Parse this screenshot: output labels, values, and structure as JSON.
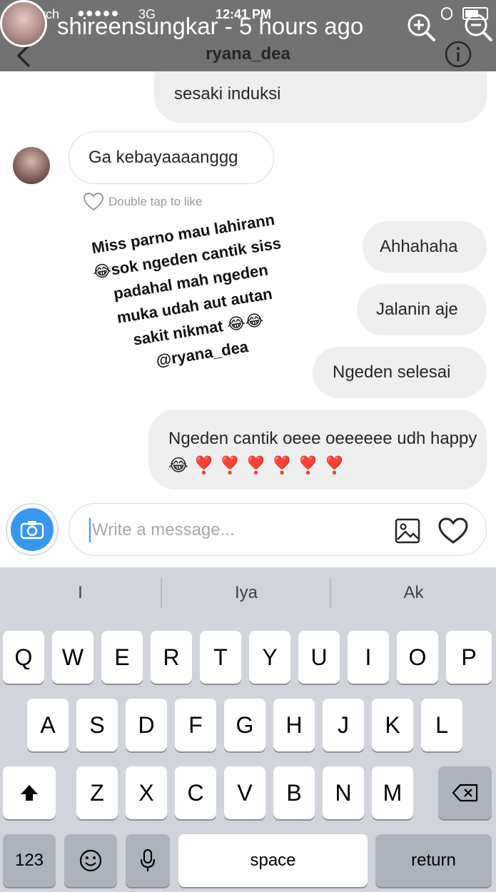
{
  "status_bar": {
    "carrier": "rch",
    "signal": "●●●●●",
    "network": "3G",
    "time": "12:41 PM"
  },
  "story": {
    "username": "shireensungkar",
    "separator": " - ",
    "age": "5 hours ago",
    "caption": "Miss parno mau lahirann\n😂sok ngeden cantik siss\npadahal mah ngeden\nmuka udah aut autan\nsakit nikmat 😂😂\n@ryana_dea"
  },
  "chat": {
    "title": "ryana_dea",
    "messages": [
      {
        "direction": "outgoing",
        "text": "sesaki induksi"
      },
      {
        "direction": "incoming",
        "text": "Ga kebayaaaanggg"
      },
      {
        "direction": "outgoing",
        "text": "Ahhahaha"
      },
      {
        "direction": "outgoing",
        "text": "Jalanin aje"
      },
      {
        "direction": "outgoing",
        "text": "Ngeden selesai"
      },
      {
        "direction": "outgoing",
        "text": "Ngeden cantik oeee oeeeeee udh happy 😂 ❣️ ❣️ ❣️ ❣️ ❣️ ❣️"
      }
    ],
    "like_hint": "Double tap to like"
  },
  "composer": {
    "placeholder": "Write a message...",
    "value": ""
  },
  "keyboard": {
    "suggestions": [
      "I",
      "Iya",
      "Ak"
    ],
    "row1": [
      "Q",
      "W",
      "E",
      "R",
      "T",
      "Y",
      "U",
      "I",
      "O",
      "P"
    ],
    "row2": [
      "A",
      "S",
      "D",
      "F",
      "G",
      "H",
      "J",
      "K",
      "L"
    ],
    "row3": [
      "Z",
      "X",
      "C",
      "V",
      "B",
      "N",
      "M"
    ],
    "numbers_label": "123",
    "space_label": "space",
    "return_label": "return"
  },
  "icons": {
    "back": "chevron-left-icon",
    "info": "info-icon",
    "zoom_in": "zoom-in-icon",
    "zoom_out": "zoom-out-icon",
    "camera": "camera-icon",
    "gallery": "image-icon",
    "heart": "heart-icon",
    "shift": "shift-icon",
    "delete": "backspace-icon",
    "emoji": "emoji-icon",
    "mic": "microphone-icon"
  },
  "colors": {
    "accent": "#3897f0",
    "bubble_outgoing": "#efefef",
    "keyboard_bg": "#d1d5db"
  }
}
